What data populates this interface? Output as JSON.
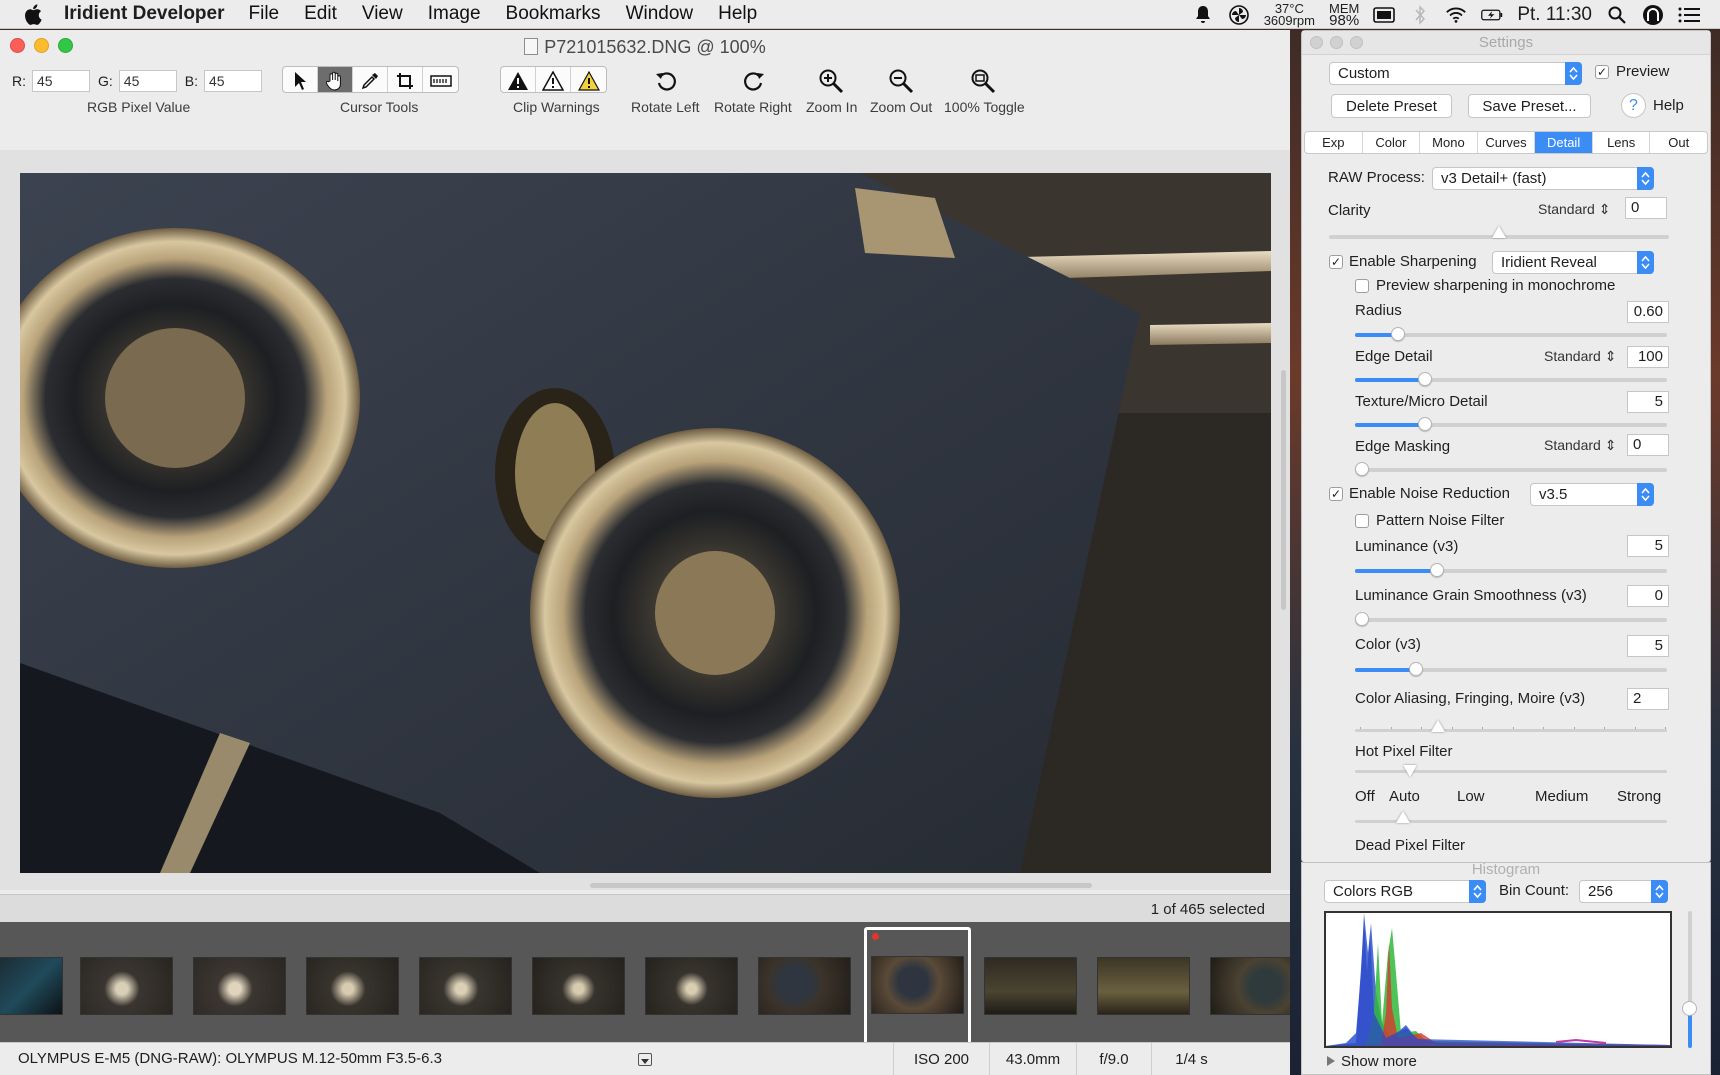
{
  "menubar": {
    "app_name": "Iridient Developer",
    "menus": [
      "File",
      "Edit",
      "View",
      "Image",
      "Bookmarks",
      "Window",
      "Help"
    ],
    "temp": "37°C",
    "fan": "3609rpm",
    "mem_label": "MEM",
    "mem_value": "98%",
    "clock": "Pt. 11:30"
  },
  "window": {
    "title": "P721015632.DNG @ 100%",
    "rgb": {
      "r_label": "R:",
      "r_value": "45",
      "g_label": "G:",
      "g_value": "45",
      "b_label": "B:",
      "b_value": "45",
      "caption": "RGB Pixel Value"
    },
    "toolbar": {
      "cursor_tools": "Cursor Tools",
      "clip_warnings": "Clip Warnings",
      "rotate_left": "Rotate Left",
      "rotate_right": "Rotate Right",
      "zoom_in": "Zoom In",
      "zoom_out": "Zoom Out",
      "toggle_100": "100% Toggle"
    },
    "selection_text": "1 of 465 selected",
    "status": {
      "camera": "OLYMPUS E-M5 (DNG-RAW): OLYMPUS M.12-50mm F3.5-6.3",
      "iso": "ISO 200",
      "focal": "43.0mm",
      "aperture": "f/9.0",
      "shutter": "1/4 s"
    }
  },
  "settings": {
    "title": "Settings",
    "preset": "Custom",
    "preview_label": "Preview",
    "preview_checked": true,
    "delete_preset": "Delete Preset",
    "save_preset": "Save Preset...",
    "help": "Help",
    "tabs": [
      "Exp",
      "Color",
      "Mono",
      "Curves",
      "Detail",
      "Lens",
      "Out"
    ],
    "active_tab": "Detail",
    "raw_process_label": "RAW Process:",
    "raw_process_value": "v3 Detail+ (fast)",
    "clarity_label": "Clarity",
    "clarity_mode": "Standard",
    "clarity_value": "0",
    "clarity_level": 0.5,
    "enable_sharpening": "Enable Sharpening",
    "sharpening_method": "Iridient Reveal",
    "preview_mono": "Preview sharpening in monochrome",
    "radius_label": "Radius",
    "radius_value": "0.60",
    "radius_level": 0.12,
    "edge_detail_label": "Edge Detail",
    "edge_detail_mode": "Standard",
    "edge_detail_value": "100",
    "edge_detail_level": 0.21,
    "texture_label": "Texture/Micro Detail",
    "texture_value": "5",
    "texture_level": 0.21,
    "edge_masking_label": "Edge Masking",
    "edge_masking_mode": "Standard",
    "edge_masking_value": "0",
    "edge_masking_level": 0.0,
    "enable_noise": "Enable Noise Reduction",
    "noise_version": "v3.5",
    "pattern_noise": "Pattern Noise Filter",
    "luminance_label": "Luminance (v3)",
    "luminance_value": "5",
    "luminance_level": 0.25,
    "grain_label": "Luminance Grain Smoothness (v3)",
    "grain_value": "0",
    "grain_level": 0.0,
    "color_label": "Color (v3)",
    "color_value": "5",
    "color_level": 0.18,
    "aliasing_label": "Color Aliasing, Fringing, Moire (v3)",
    "aliasing_value": "2",
    "hot_pixel_label": "Hot Pixel Filter",
    "hot_pixel_scale": [
      "Off",
      "Auto",
      "Low",
      "Medium",
      "Strong"
    ],
    "dead_pixel_label": "Dead Pixel Filter"
  },
  "histogram": {
    "title": "Histogram",
    "mode": "Colors RGB",
    "bin_label": "Bin Count:",
    "bin_value": "256",
    "show_more": "Show more"
  },
  "colors": {
    "accent": "#3b8cf5",
    "close": "#fc5f57",
    "minimize": "#fdbc2e",
    "zoom": "#33c748"
  }
}
